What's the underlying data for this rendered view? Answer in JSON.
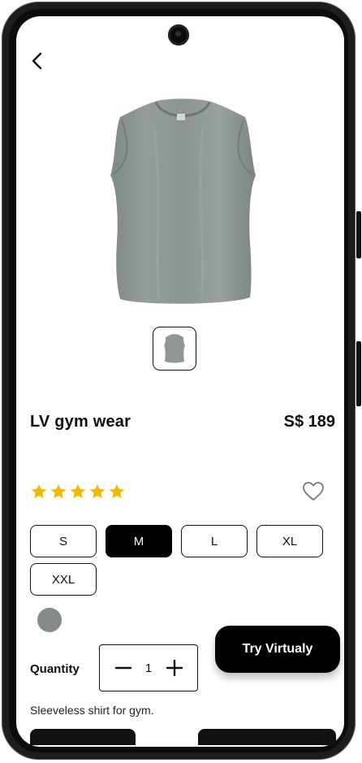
{
  "product": {
    "name": "LV gym wear",
    "price": "S$ 189",
    "description": "Sleeveless shirt for gym.",
    "rating": 5,
    "rating_max": 5,
    "image_icon": "sleeveless-shirt",
    "shirt_color": "#8e9795"
  },
  "nav": {
    "back_icon": "chevron-left-icon"
  },
  "sizes": {
    "options": [
      "S",
      "M",
      "L",
      "XL",
      "XXL"
    ],
    "selected": "M"
  },
  "colors": {
    "options": [
      "#858b8a"
    ]
  },
  "quantity": {
    "label": "Quantity",
    "value": "1"
  },
  "actions": {
    "try_label": "Try Virtualy",
    "favorite_icon": "heart-outline-icon"
  },
  "theme": {
    "star_color": "#f5b800",
    "primary": "#000000",
    "background": "#ffffff"
  }
}
